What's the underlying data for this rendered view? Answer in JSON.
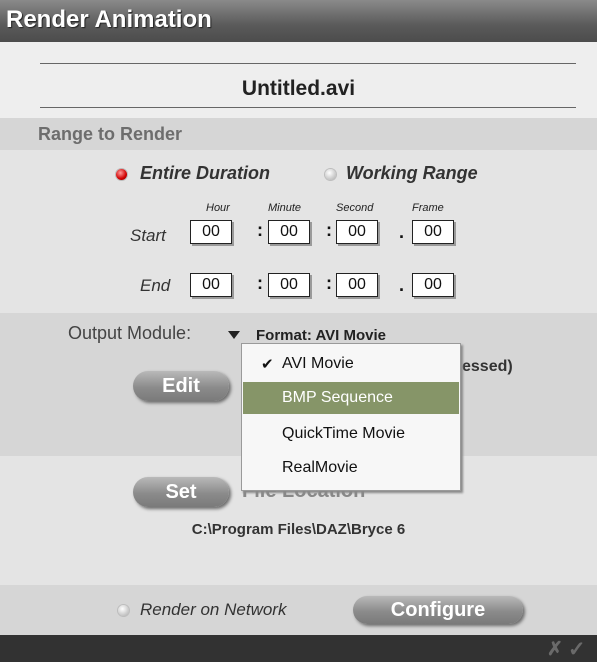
{
  "window": {
    "title": "Render Animation"
  },
  "file": {
    "name": "Untitled.avi"
  },
  "range": {
    "title": "Range to Render",
    "option_entire": "Entire Duration",
    "option_working": "Working Range",
    "col_hour": "Hour",
    "col_minute": "Minute",
    "col_second": "Second",
    "col_frame": "Frame",
    "start_label": "Start",
    "end_label": "End",
    "start": [
      "00",
      "00",
      "00",
      "00"
    ],
    "end": [
      "00",
      "00",
      "00",
      "00"
    ]
  },
  "output": {
    "label": "Output Module:",
    "format": "Format: AVI Movie",
    "compression_partial": "essed)",
    "edit": "Edit",
    "menu": {
      "items": [
        "AVI Movie",
        "BMP Sequence",
        "QuickTime Movie",
        "RealMovie"
      ],
      "checked": "AVI Movie",
      "highlighted": "BMP Sequence"
    }
  },
  "location": {
    "set": "Set",
    "label": "File Location",
    "path": "C:\\Program Files\\DAZ\\Bryce 6"
  },
  "network": {
    "label": "Render on Network",
    "configure": "Configure"
  },
  "colors": {
    "highlight": "#869568",
    "radio_selected": "#d00000"
  }
}
